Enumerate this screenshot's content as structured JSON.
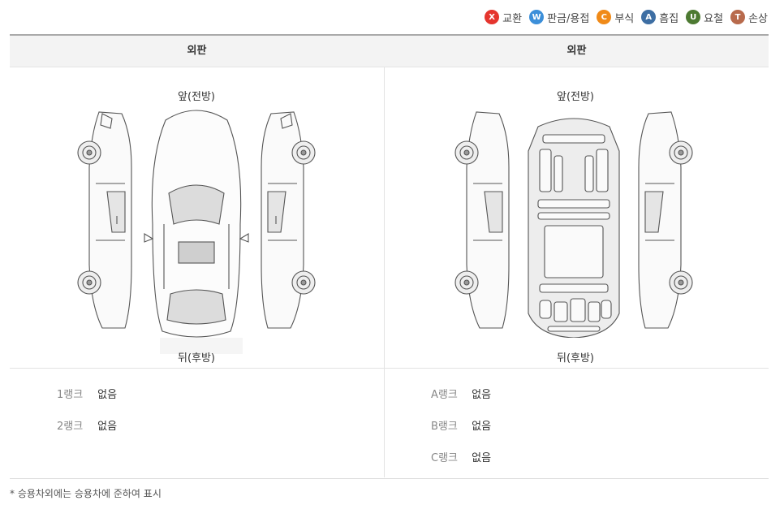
{
  "legend": [
    {
      "letter": "X",
      "label": "교환",
      "color": "#e5352e"
    },
    {
      "letter": "W",
      "label": "판금/용접",
      "color": "#3c8fd9"
    },
    {
      "letter": "C",
      "label": "부식",
      "color": "#f08a18"
    },
    {
      "letter": "A",
      "label": "흠집",
      "color": "#3d6ea3"
    },
    {
      "letter": "U",
      "label": "요철",
      "color": "#4d7a32"
    },
    {
      "letter": "T",
      "label": "손상",
      "color": "#b86a4c"
    }
  ],
  "panels": {
    "left": {
      "header": "외판",
      "front_label": "앞(전방)",
      "rear_label": "뒤(후방)"
    },
    "right": {
      "header": "외판",
      "front_label": "앞(전방)",
      "rear_label": "뒤(후방)"
    }
  },
  "ranks_left": [
    {
      "label": "1랭크",
      "value": "없음"
    },
    {
      "label": "2랭크",
      "value": "없음"
    }
  ],
  "ranks_right": [
    {
      "label": "A랭크",
      "value": "없음"
    },
    {
      "label": "B랭크",
      "value": "없음"
    },
    {
      "label": "C랭크",
      "value": "없음"
    }
  ],
  "footnote": "* 승용차외에는 승용차에 준하여 표시"
}
